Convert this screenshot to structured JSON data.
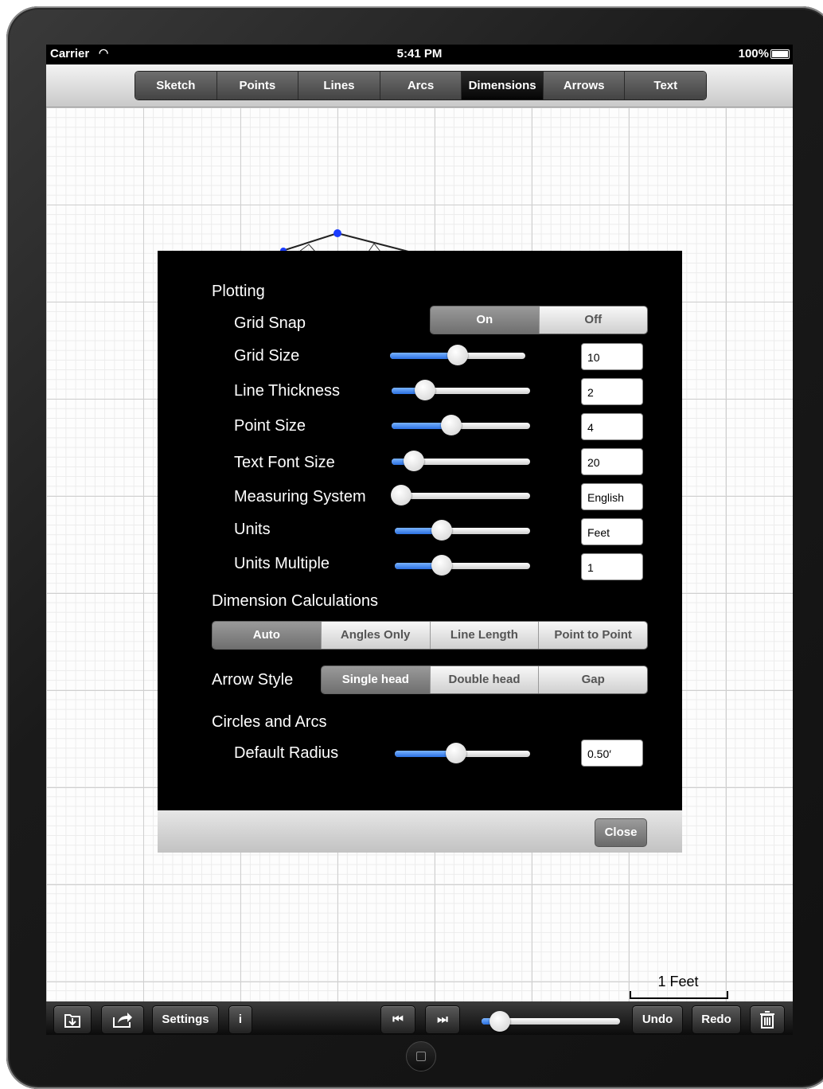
{
  "status": {
    "carrier": "Carrier",
    "time": "5:41 PM",
    "battery": "100%"
  },
  "tabs": [
    "Sketch",
    "Points",
    "Lines",
    "Arcs",
    "Dimensions",
    "Arrows",
    "Text"
  ],
  "active_tab": "Dimensions",
  "settings": {
    "plotting_title": "Plotting",
    "grid_snap": {
      "label": "Grid Snap",
      "options": [
        "On",
        "Off"
      ],
      "selected": "On"
    },
    "rows": [
      {
        "label": "Grid Size",
        "value": "10",
        "level": 0.5
      },
      {
        "label": "Line Thickness",
        "value": "2",
        "level": 0.24
      },
      {
        "label": "Point Size",
        "value": "4",
        "level": 0.43
      },
      {
        "label": "Text Font Size",
        "value": "20",
        "level": 0.16
      },
      {
        "label": "Measuring System",
        "value": "English",
        "level": 0.07
      },
      {
        "label": "Units",
        "value": "Feet",
        "level": 0.35
      },
      {
        "label": "Units Multiple",
        "value": "1",
        "level": 0.35
      }
    ],
    "dimension_calc": {
      "title": "Dimension Calculations",
      "options": [
        "Auto",
        "Angles Only",
        "Line Length",
        "Point to Point"
      ],
      "selected": "Auto"
    },
    "arrow_style": {
      "label": "Arrow Style",
      "options": [
        "Single head",
        "Double head",
        "Gap"
      ],
      "selected": "Single head"
    },
    "circles_title": "Circles and Arcs",
    "default_radius": {
      "label": "Default Radius",
      "value": "0.50′",
      "level": 0.45
    },
    "close_label": "Close"
  },
  "canvas": {
    "scale_label": "1 Feet"
  },
  "toolbar": {
    "settings_label": "Settings",
    "info_label": "i",
    "undo_label": "Undo",
    "redo_label": "Redo",
    "playback_level": 0.1
  },
  "colors": {
    "slider_fill": "#2a6fe0",
    "point": "#1a3cff"
  }
}
